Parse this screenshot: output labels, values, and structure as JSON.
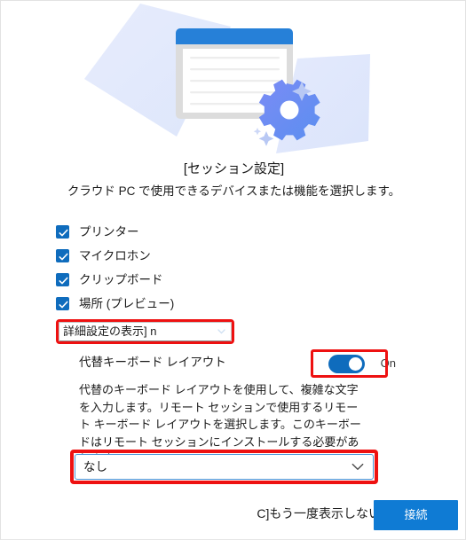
{
  "dialog": {
    "title": "[セッション設定]",
    "subtitle": "クラウド PC で使用できるデバイスまたは機能を選択します。"
  },
  "illustration": {
    "name": "session-settings-illustration",
    "window_titlebar_color": "#2680d8",
    "card_back_color": "#dde5fa",
    "gear_color": "#6b7ff0",
    "page_color": "#ffffff"
  },
  "checkboxes": [
    {
      "label": "プリンター",
      "checked": true,
      "name": "checkbox-printer"
    },
    {
      "label": "マイクロホン",
      "checked": true,
      "name": "checkbox-microphone"
    },
    {
      "label": "クリップボード",
      "checked": true,
      "name": "checkbox-clipboard"
    },
    {
      "label": "場所 (プレビュー)",
      "checked": true,
      "name": "checkbox-location"
    }
  ],
  "advanced_field": {
    "value": "詳細設定の表示] n",
    "chevron": "chevron-down-icon",
    "highlight_color": "#ee1111"
  },
  "keyboard_layout": {
    "label": "代替キーボード レイアウト",
    "toggle_state": "On",
    "toggle_on": true,
    "toggle_color": "#0f6cbd",
    "highlight_color": "#ee1111",
    "description": "代替のキーボード レイアウトを使用して、複雑な文字を入力します。リモート セッションで使用するリモート キーボード レイアウトを選択します。このキーボードはリモート セッションにインストールする必要があります。"
  },
  "layout_select": {
    "value": "なし",
    "chevron": "chevron-down-icon",
    "border_color": "#4a94d8",
    "highlight_color": "#ee1111"
  },
  "footer": {
    "dont_show_again_text": "C]もう一度表示しない",
    "connect_label": "接続",
    "connect_color": "#0f7bd4"
  }
}
